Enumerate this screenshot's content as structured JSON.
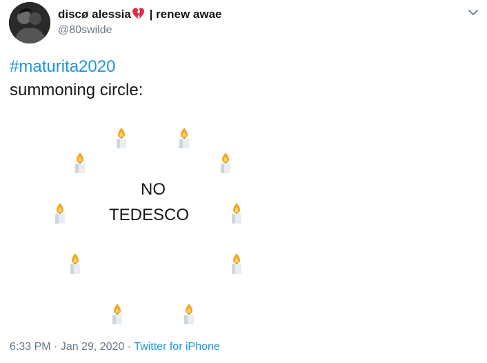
{
  "author": {
    "name": "discø alessia",
    "name_suffix": "| renew awae",
    "handle": "@80swilde",
    "name_emoji": "broken-heart-icon"
  },
  "tweet": {
    "hashtag": "#maturita2020",
    "line2": "summoning circle:",
    "circle_line1": "NO",
    "circle_line2": "TEDESCO",
    "candle_emoji": "candle-icon",
    "candle_count": 10
  },
  "meta": {
    "time": "6:33 PM",
    "separator": " · ",
    "date": "Jan 29, 2020",
    "source": "Twitter for iPhone"
  },
  "colors": {
    "link": "#1b95e0",
    "secondary": "#657786",
    "text": "#14171a",
    "flame": "#f4a623",
    "wax": "#e9edf2",
    "heart": "#dd2e44"
  }
}
